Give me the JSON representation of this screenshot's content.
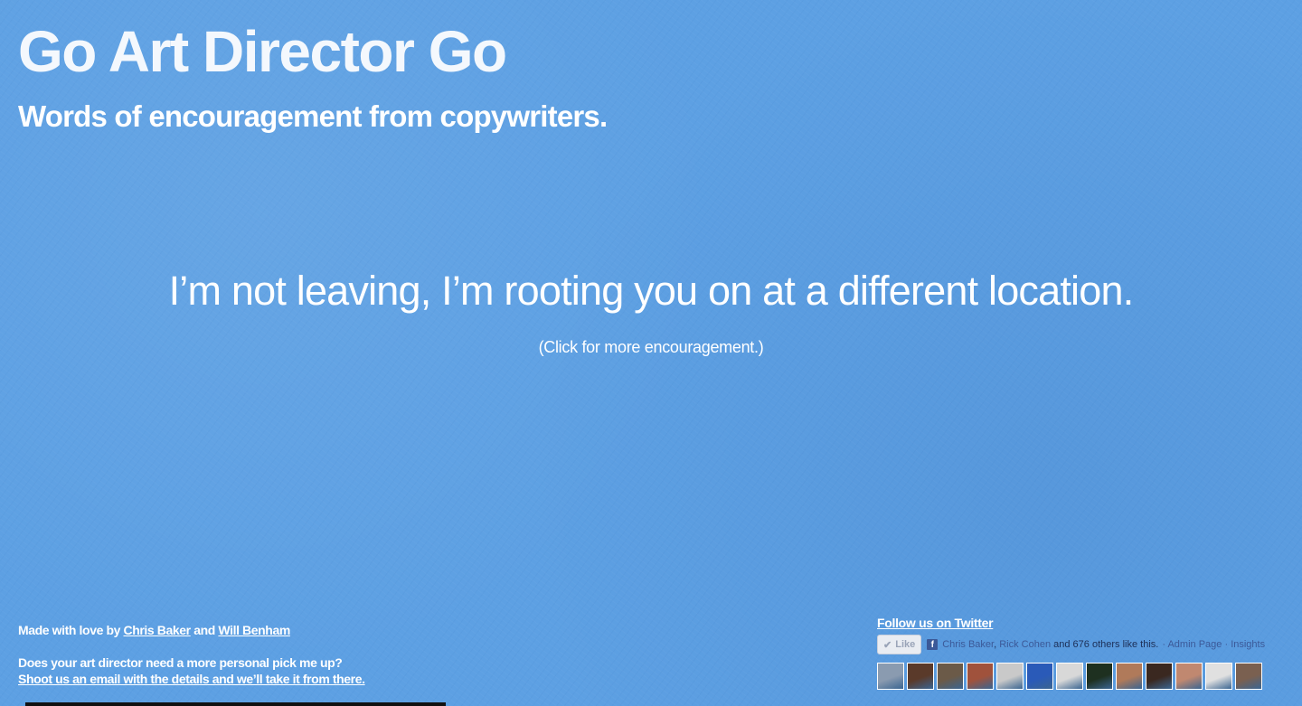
{
  "header": {
    "title": "Go Art Director Go",
    "tagline": "Words of encouragement from copywriters."
  },
  "main": {
    "quote": "I’m not leaving, I’m rooting you on at a different location.",
    "more_link": "(Click for more encouragement.)"
  },
  "footer": {
    "made_prefix": "Made with love by",
    "author1": "Chris Baker",
    "and_text": "and",
    "author2": "Will Benham",
    "pitch_question": "Does your art director need a more personal pick me up?",
    "pitch_link": "Shoot us an email with the details and we’ll take it from there."
  },
  "social": {
    "twitter_link": "Follow us on Twitter",
    "like_label": "Like",
    "like_icon": "check-icon",
    "fb_name1": "Chris Baker",
    "fb_sep": ", ",
    "fb_name2": "Rick Cohen",
    "fb_rest": " and 676 others like this.",
    "fb_dot": "·",
    "admin_page": "Admin Page",
    "insights": "Insights",
    "faces": [
      {
        "color": "#8a9bb0"
      },
      {
        "color": "#5a3a2a"
      },
      {
        "color": "#6b5a48"
      },
      {
        "color": "#a0523c"
      },
      {
        "color": "#c9c9c9"
      },
      {
        "color": "#2a5ab8"
      },
      {
        "color": "#d8d8d8"
      },
      {
        "color": "#1e3020"
      },
      {
        "color": "#b07a5a"
      },
      {
        "color": "#3a2820"
      },
      {
        "color": "#c08870"
      },
      {
        "color": "#e0e0e0"
      },
      {
        "color": "#7a6050"
      }
    ]
  },
  "colors": {
    "background": "#5da0e3",
    "text": "#ffffff",
    "facebook": "#3b5998"
  }
}
